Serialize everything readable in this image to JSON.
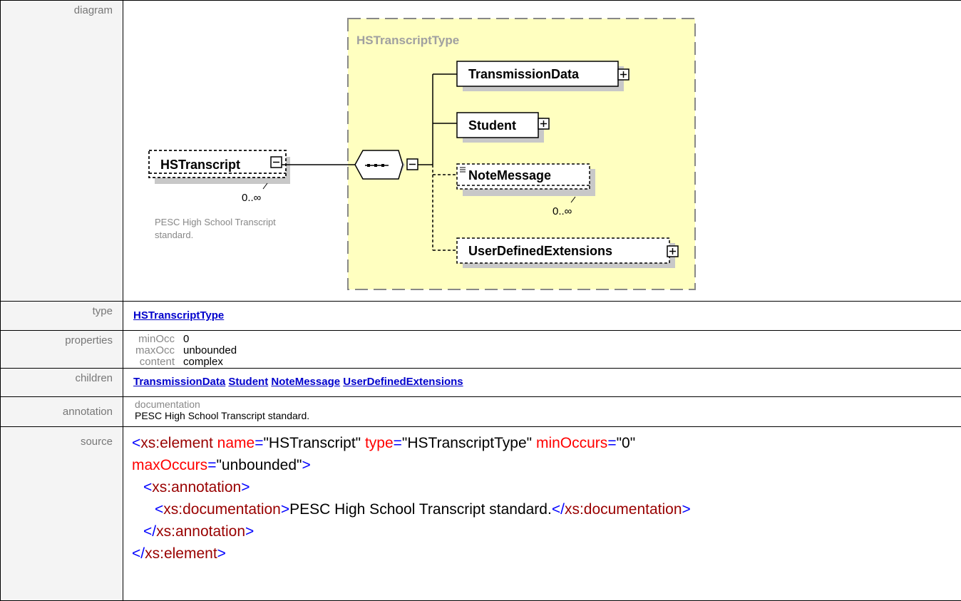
{
  "rows": {
    "diagram": {
      "label": "diagram",
      "type_box_title": "HSTranscriptType",
      "root_element": "HSTranscript",
      "root_occurrence": "0..∞",
      "root_doc": [
        "PESC High School Transcript",
        "standard."
      ],
      "children": [
        {
          "name": "TransmissionData"
        },
        {
          "name": "Student"
        },
        {
          "name": "NoteMessage",
          "occurrence": "0..∞"
        },
        {
          "name": "UserDefinedExtensions"
        }
      ]
    },
    "type": {
      "label": "type",
      "value": "HSTranscriptType"
    },
    "properties": {
      "label": "properties",
      "items": [
        {
          "key": "minOcc",
          "value": "0"
        },
        {
          "key": "maxOcc",
          "value": "unbounded"
        },
        {
          "key": "content",
          "value": "complex"
        }
      ]
    },
    "children": {
      "label": "children",
      "links": [
        "TransmissionData",
        "Student",
        "NoteMessage",
        "UserDefinedExtensions"
      ]
    },
    "annotation": {
      "label": "annotation",
      "key": "documentation",
      "value": "PESC High School Transcript standard."
    },
    "source": {
      "label": "source",
      "el_open": "<xs:element",
      "attr_name": "name",
      "name_val": "\"HSTranscript\"",
      "attr_type": "type",
      "type_val": "\"HSTranscriptType\"",
      "attr_min": "minOccurs",
      "min_val": "\"0\"",
      "attr_max": "maxOccurs",
      "max_val": "\"unbounded\"",
      "ann_open": "<xs:annotation>",
      "doc_open": "<xs:documentation>",
      "doc_text": "PESC High School Transcript standard.",
      "doc_close": "</xs:documentation>",
      "ann_close": "</xs:annotation>",
      "el_close": "</xs:element>"
    }
  },
  "colors": {
    "type_box_fill": "#ffffc0",
    "link": "#0000cc",
    "xml_tag": "#990000",
    "xml_attr": "#ff0000",
    "xml_punct": "#0000ff",
    "label_text": "#777777"
  }
}
